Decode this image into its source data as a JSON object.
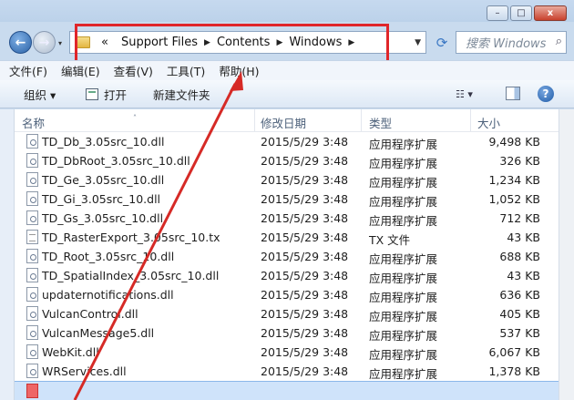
{
  "window": {
    "min_icon": "minimize-icon",
    "max_icon": "maximize-icon",
    "close_glyph": "x"
  },
  "nav": {
    "back_glyph": "←",
    "forward_glyph": "→",
    "history_glyph": "▾"
  },
  "address": {
    "overflow": "«",
    "crumbs": [
      "Support Files",
      "Contents",
      "Windows"
    ],
    "sep": "▶",
    "dropdown": "▼",
    "refresh_glyph": "⟳"
  },
  "search": {
    "placeholder": "搜索 Windows",
    "icon": "⌕"
  },
  "menu": [
    "文件(F)",
    "编辑(E)",
    "查看(V)",
    "工具(T)",
    "帮助(H)"
  ],
  "toolbar": {
    "organize": "组织 ▾",
    "open": "打开",
    "new_folder": "新建文件夹",
    "view_glyph": "☷ ▾",
    "help_glyph": "?"
  },
  "columns": {
    "name": "名称",
    "modified": "修改日期",
    "type": "类型",
    "size": "大小",
    "sort_glyph": "˄"
  },
  "files": [
    {
      "name": "TD_Db_3.05src_10.dll",
      "modified": "2015/5/29 3:48",
      "type": "应用程序扩展",
      "size": "9,498 KB",
      "kind": "dll"
    },
    {
      "name": "TD_DbRoot_3.05src_10.dll",
      "modified": "2015/5/29 3:48",
      "type": "应用程序扩展",
      "size": "326 KB",
      "kind": "dll"
    },
    {
      "name": "TD_Ge_3.05src_10.dll",
      "modified": "2015/5/29 3:48",
      "type": "应用程序扩展",
      "size": "1,234 KB",
      "kind": "dll"
    },
    {
      "name": "TD_Gi_3.05src_10.dll",
      "modified": "2015/5/29 3:48",
      "type": "应用程序扩展",
      "size": "1,052 KB",
      "kind": "dll"
    },
    {
      "name": "TD_Gs_3.05src_10.dll",
      "modified": "2015/5/29 3:48",
      "type": "应用程序扩展",
      "size": "712 KB",
      "kind": "dll"
    },
    {
      "name": "TD_RasterExport_3.05src_10.tx",
      "modified": "2015/5/29 3:48",
      "type": "TX 文件",
      "size": "43 KB",
      "kind": "txt"
    },
    {
      "name": "TD_Root_3.05src_10.dll",
      "modified": "2015/5/29 3:48",
      "type": "应用程序扩展",
      "size": "688 KB",
      "kind": "dll"
    },
    {
      "name": "TD_SpatialIndex_3.05src_10.dll",
      "modified": "2015/5/29 3:48",
      "type": "应用程序扩展",
      "size": "43 KB",
      "kind": "dll"
    },
    {
      "name": "updaternotifications.dll",
      "modified": "2015/5/29 3:48",
      "type": "应用程序扩展",
      "size": "636 KB",
      "kind": "dll"
    },
    {
      "name": "VulcanControl.dll",
      "modified": "2015/5/29 3:48",
      "type": "应用程序扩展",
      "size": "405 KB",
      "kind": "dll"
    },
    {
      "name": "VulcanMessage5.dll",
      "modified": "2015/5/29 3:48",
      "type": "应用程序扩展",
      "size": "537 KB",
      "kind": "dll"
    },
    {
      "name": "WebKit.dll",
      "modified": "2015/5/29 3:48",
      "type": "应用程序扩展",
      "size": "6,067 KB",
      "kind": "dll"
    },
    {
      "name": "WRServices.dll",
      "modified": "2015/5/29 3:48",
      "type": "应用程序扩展",
      "size": "1,378 KB",
      "kind": "dll"
    }
  ],
  "annotation": {
    "color": "#e0262a"
  }
}
